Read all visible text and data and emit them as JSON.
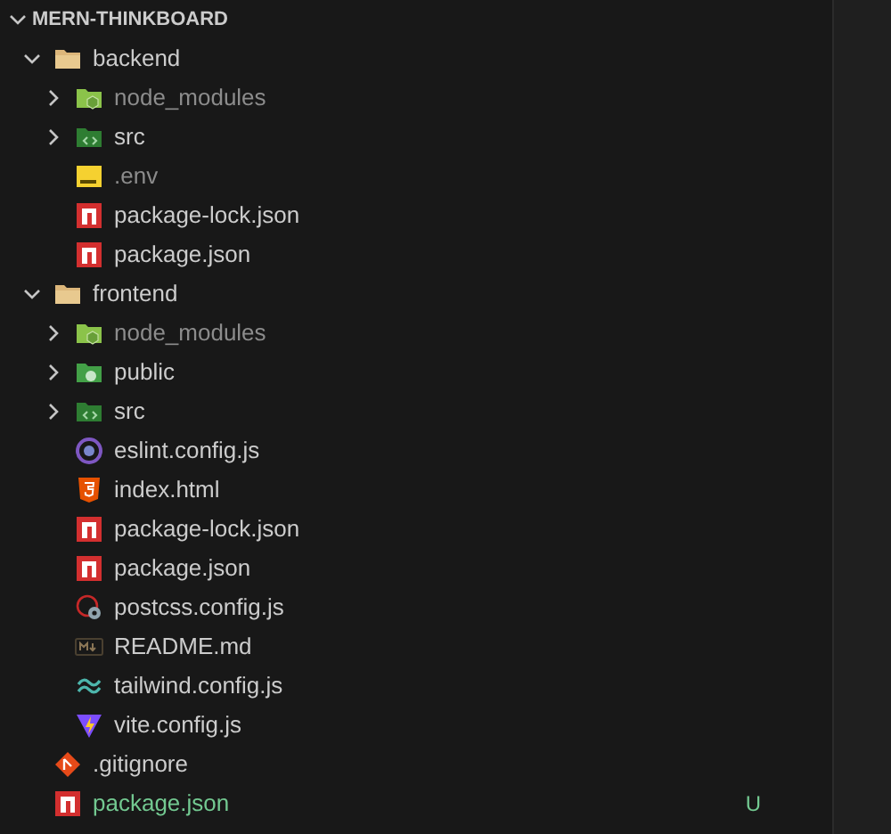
{
  "explorer": {
    "title": "MERN-THINKBOARD",
    "expanded": true,
    "items": [
      {
        "name": "backend",
        "kind": "folder",
        "expanded": true,
        "children": [
          {
            "name": "node_modules",
            "kind": "modules",
            "expanded": false,
            "ignored": true
          },
          {
            "name": "src",
            "kind": "source",
            "expanded": false,
            "ignored": false
          },
          {
            "name": ".env",
            "kind": "env",
            "ignored": true
          },
          {
            "name": "package-lock.json",
            "kind": "npm",
            "ignored": false
          },
          {
            "name": "package.json",
            "kind": "npm",
            "ignored": false
          }
        ]
      },
      {
        "name": "frontend",
        "kind": "folder",
        "expanded": true,
        "children": [
          {
            "name": "node_modules",
            "kind": "modules",
            "expanded": false,
            "ignored": true
          },
          {
            "name": "public",
            "kind": "assets",
            "expanded": false,
            "ignored": false
          },
          {
            "name": "src",
            "kind": "source",
            "expanded": false,
            "ignored": false
          },
          {
            "name": "eslint.config.js",
            "kind": "eslint",
            "ignored": false
          },
          {
            "name": "index.html",
            "kind": "html",
            "ignored": false
          },
          {
            "name": "package-lock.json",
            "kind": "npm",
            "ignored": false
          },
          {
            "name": "package.json",
            "kind": "npm",
            "ignored": false
          },
          {
            "name": "postcss.config.js",
            "kind": "postcss",
            "ignored": false
          },
          {
            "name": "README.md",
            "kind": "markdown",
            "ignored": false
          },
          {
            "name": "tailwind.config.js",
            "kind": "tailwind",
            "ignored": false
          },
          {
            "name": "vite.config.js",
            "kind": "vite",
            "ignored": false
          }
        ]
      },
      {
        "name": ".gitignore",
        "kind": "git",
        "untracked": false
      },
      {
        "name": "package.json",
        "kind": "npm",
        "untracked": true,
        "badge": "U"
      }
    ]
  }
}
